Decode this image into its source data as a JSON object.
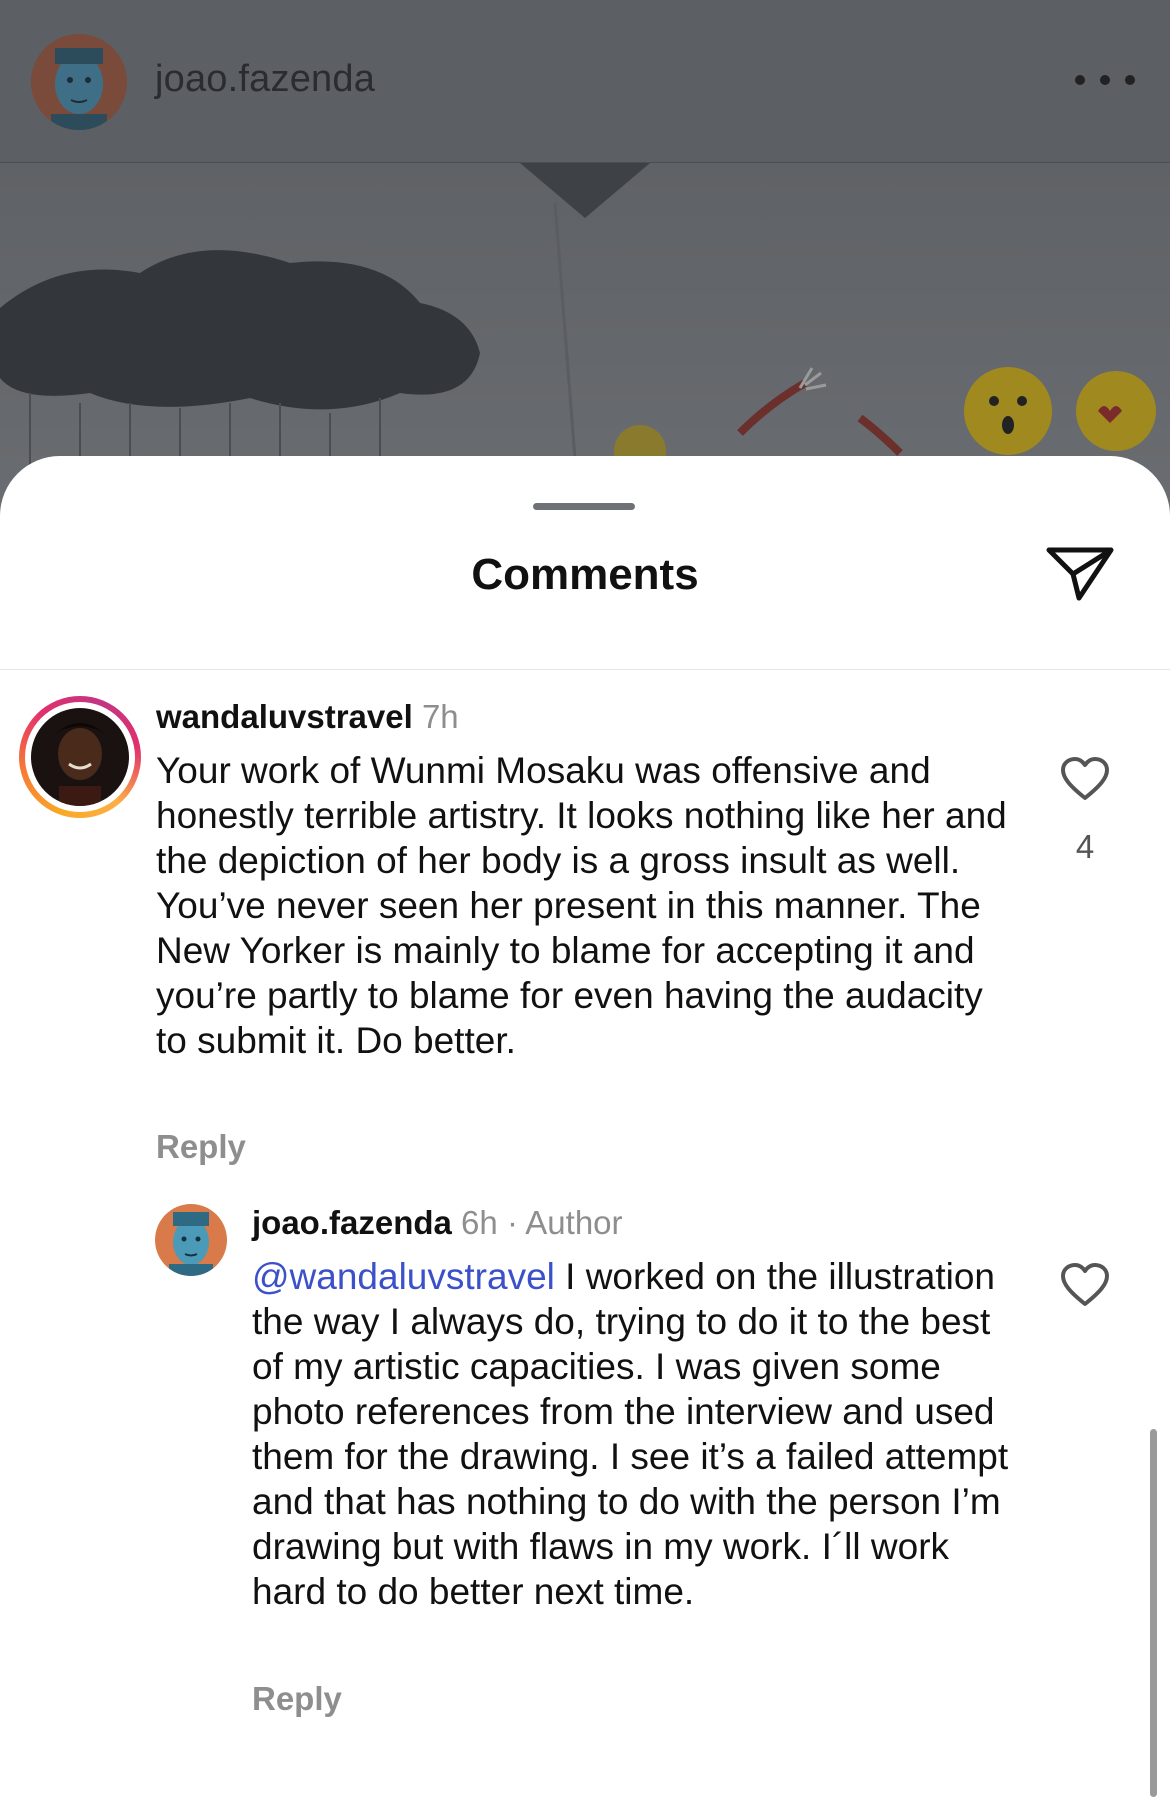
{
  "post": {
    "username": "joao.fazenda",
    "more_icon": "more-horizontal-icon"
  },
  "comments_sheet": {
    "title": "Comments",
    "share_icon": "send-icon"
  },
  "comments": [
    {
      "username": "wandaluvstravel",
      "time": "7h",
      "text": "Your work of Wunmi Mosaku was offensive and honestly terrible artistry. It looks nothing like her and the depiction of her body is a gross insult as well. You’ve never seen her present in this manner. The New Yorker is mainly to blame for accepting it and you’re partly to blame for even having the audacity to submit it. Do better.",
      "reply_label": "Reply",
      "likes": "4"
    },
    {
      "username": "joao.fazenda",
      "time": "6h",
      "separator": "·",
      "badge": "Author",
      "mention": "@wandaluvstravel",
      "text": " I worked on the illustration the way I always do, trying to do it to the best of my artistic capacities. I was given some photo references from the interview and used them for the drawing. I see it’s a failed attempt and that has nothing to do with the person I’m drawing but with flaws in my work. I´ll work hard to do better next time.",
      "reply_label": "Reply"
    }
  ],
  "colors": {
    "mention": "#3b50c9",
    "secondary_text": "#8e8e8e",
    "primary_text": "#111111"
  }
}
